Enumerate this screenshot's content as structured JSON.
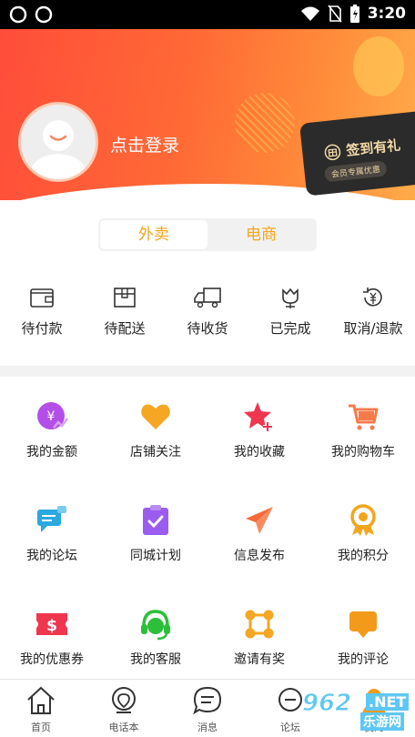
{
  "status_bar": {
    "time": "3:20"
  },
  "header": {
    "login_text": "点击登录",
    "sign_card": {
      "title": "签到有礼",
      "subtitle": "会员专属优惠"
    }
  },
  "tabs": {
    "active": "外卖",
    "other": "电商"
  },
  "orders": [
    {
      "label": "待付款",
      "icon": "wallet-icon"
    },
    {
      "label": "待配送",
      "icon": "box-icon"
    },
    {
      "label": "待收货",
      "icon": "truck-icon"
    },
    {
      "label": "已完成",
      "icon": "flower-icon"
    },
    {
      "label": "取消/退款",
      "icon": "refund-icon"
    }
  ],
  "grid": [
    {
      "label": "我的金额",
      "icon": "money-icon",
      "color": "#b34fe8"
    },
    {
      "label": "店铺关注",
      "icon": "heart-icon",
      "color": "#f5a623"
    },
    {
      "label": "我的收藏",
      "icon": "star-icon",
      "color": "#f0364f"
    },
    {
      "label": "我的购物车",
      "icon": "cart-icon",
      "color": "#f77a4a"
    },
    {
      "label": "我的论坛",
      "icon": "chat-icon",
      "color": "#2aa8e0"
    },
    {
      "label": "同城计划",
      "icon": "clipboard-icon",
      "color": "#9b5cf0"
    },
    {
      "label": "信息发布",
      "icon": "paper-plane-icon",
      "color": "#f56a3a"
    },
    {
      "label": "我的积分",
      "icon": "medal-icon",
      "color": "#f3a51b"
    },
    {
      "label": "我的优惠券",
      "icon": "coupon-icon",
      "color": "#f0364f"
    },
    {
      "label": "我的客服",
      "icon": "headset-icon",
      "color": "#2bbf3a"
    },
    {
      "label": "邀请有奖",
      "icon": "network-icon",
      "color": "#f5a623"
    },
    {
      "label": "我的评论",
      "icon": "comment-icon",
      "color": "#f39a1b"
    }
  ],
  "nav": [
    {
      "label": "首页",
      "icon": "home-icon"
    },
    {
      "label": "电话本",
      "icon": "location-icon"
    },
    {
      "label": "消息",
      "icon": "message-icon"
    },
    {
      "label": "论坛",
      "icon": "forum-icon"
    },
    {
      "label": "我的",
      "icon": "user-icon"
    }
  ],
  "watermark": {
    "number": "962",
    "net": ".NET",
    "name": "乐游网"
  },
  "colors": {
    "accent": "#f3a51b",
    "header_start": "#ff4d3a",
    "header_end": "#ffab4a"
  }
}
